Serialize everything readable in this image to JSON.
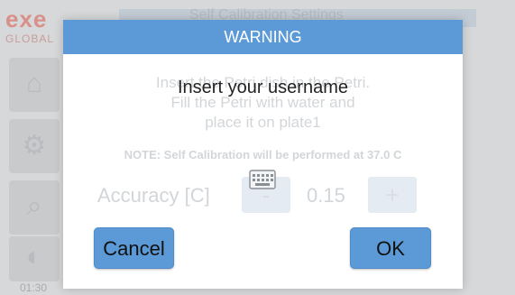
{
  "background": {
    "logo_text": "exe",
    "logo_sub": "GLOBAL",
    "header_text": "Self Calibration Settings",
    "time": "01:30"
  },
  "dialog": {
    "title": "WARNING",
    "prompt": "Insert your username",
    "ghost_lines": [
      "Insert the Petri dish in the Petri.",
      "Fill the Petri with water and",
      "place it on plate1"
    ],
    "note": "NOTE: Self Calibration will be performed at 37.0 C",
    "accuracy_label": "Accuracy [C]",
    "accuracy_minus": "-",
    "accuracy_value": "0.15",
    "accuracy_plus": "+",
    "cancel_label": "Cancel",
    "ok_label": "OK"
  },
  "colors": {
    "accent": "#5b9ad6",
    "dialog_bg": "#ffffff",
    "dim_bg": "#d7d8d9"
  },
  "icons": {
    "keyboard": "keyboard-icon"
  }
}
